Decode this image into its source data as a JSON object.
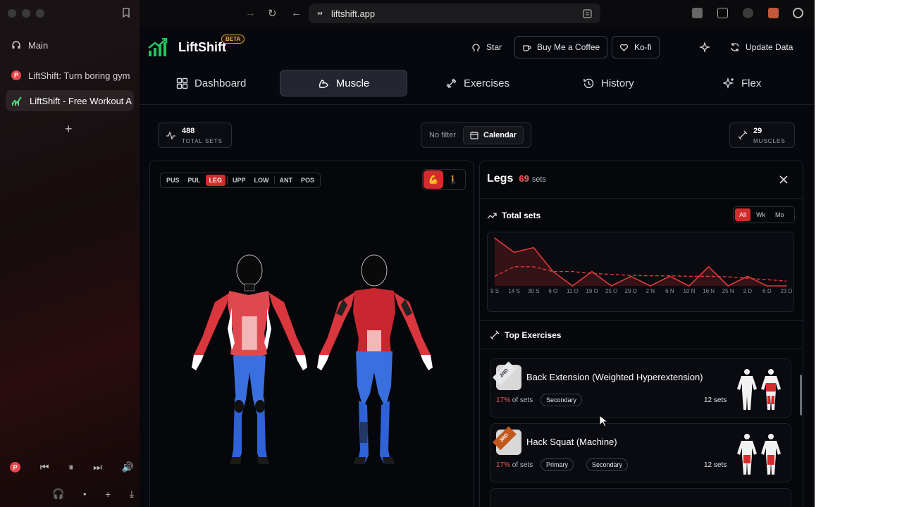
{
  "browser": {
    "url": "liftshift.app",
    "sidebar": {
      "main_label": "Main",
      "tabs": [
        {
          "label": "LiftShift: Turn boring gym"
        },
        {
          "label": "LiftShift - Free Workout A"
        }
      ]
    }
  },
  "header": {
    "logo": "LiftShift",
    "badge": "BETA",
    "star_label": "Star",
    "coffee_label": "Buy Me a Coffee",
    "kofi_label": "Ko-fi",
    "update_label": "Update Data"
  },
  "tabs": [
    {
      "label": "Dashboard",
      "icon": "grid-icon"
    },
    {
      "label": "Muscle",
      "icon": "muscle-icon"
    },
    {
      "label": "Exercises",
      "icon": "dumbbell-icon"
    },
    {
      "label": "History",
      "icon": "history-icon"
    },
    {
      "label": "Flex",
      "icon": "sparkles-icon"
    }
  ],
  "stats": {
    "total_sets": "488",
    "total_sets_label": "TOTAL SETS",
    "filter_label": "No filter",
    "calendar_label": "Calendar",
    "muscles": "29",
    "muscles_label": "MUSCLES"
  },
  "body_panel": {
    "groups": [
      "PUS",
      "PUL",
      "LEG",
      "UPP",
      "LOW",
      "ANT",
      "POS"
    ],
    "active_group": "LEG"
  },
  "detail": {
    "title": "Legs",
    "count": "69",
    "count_unit": "sets",
    "total_sets_title": "Total sets",
    "range_options": [
      "All",
      "Wk",
      "Mo"
    ],
    "active_range": "All",
    "top_exercises_title": "Top Exercises",
    "exercises": [
      {
        "rank": "2ND",
        "name": "Back Extension (Weighted Hyperextension)",
        "pct": "17%",
        "pct_suffix": "of sets",
        "tags": [
          "Secondary"
        ],
        "sets": "12 sets"
      },
      {
        "rank": "3RD",
        "name": "Hack Squat (Machine)",
        "pct": "17%",
        "pct_suffix": "of sets",
        "tags": [
          "Primary",
          "Secondary"
        ],
        "sets": "12 sets"
      }
    ]
  },
  "chart_data": {
    "type": "line",
    "title": "Total sets",
    "x": [
      "9 S",
      "14 S",
      "30 S",
      "6 O",
      "11 O",
      "19 O",
      "25 O",
      "29 O",
      "2 N",
      "6 N",
      "10 N",
      "16 N",
      "25 N",
      "2 D",
      "6 D",
      "23 D"
    ],
    "series": [
      {
        "values": [
          10,
          7,
          8,
          3,
          0,
          3,
          0,
          2,
          0,
          2,
          0,
          4,
          0,
          2,
          0,
          0
        ]
      },
      {
        "values": [
          2,
          4,
          4,
          3,
          3,
          2.6,
          2.4,
          2.2,
          2.1,
          2.1,
          2.0,
          2.0,
          1.9,
          1.6,
          1.3,
          1.0
        ]
      }
    ],
    "grid": false,
    "legend": "none"
  }
}
